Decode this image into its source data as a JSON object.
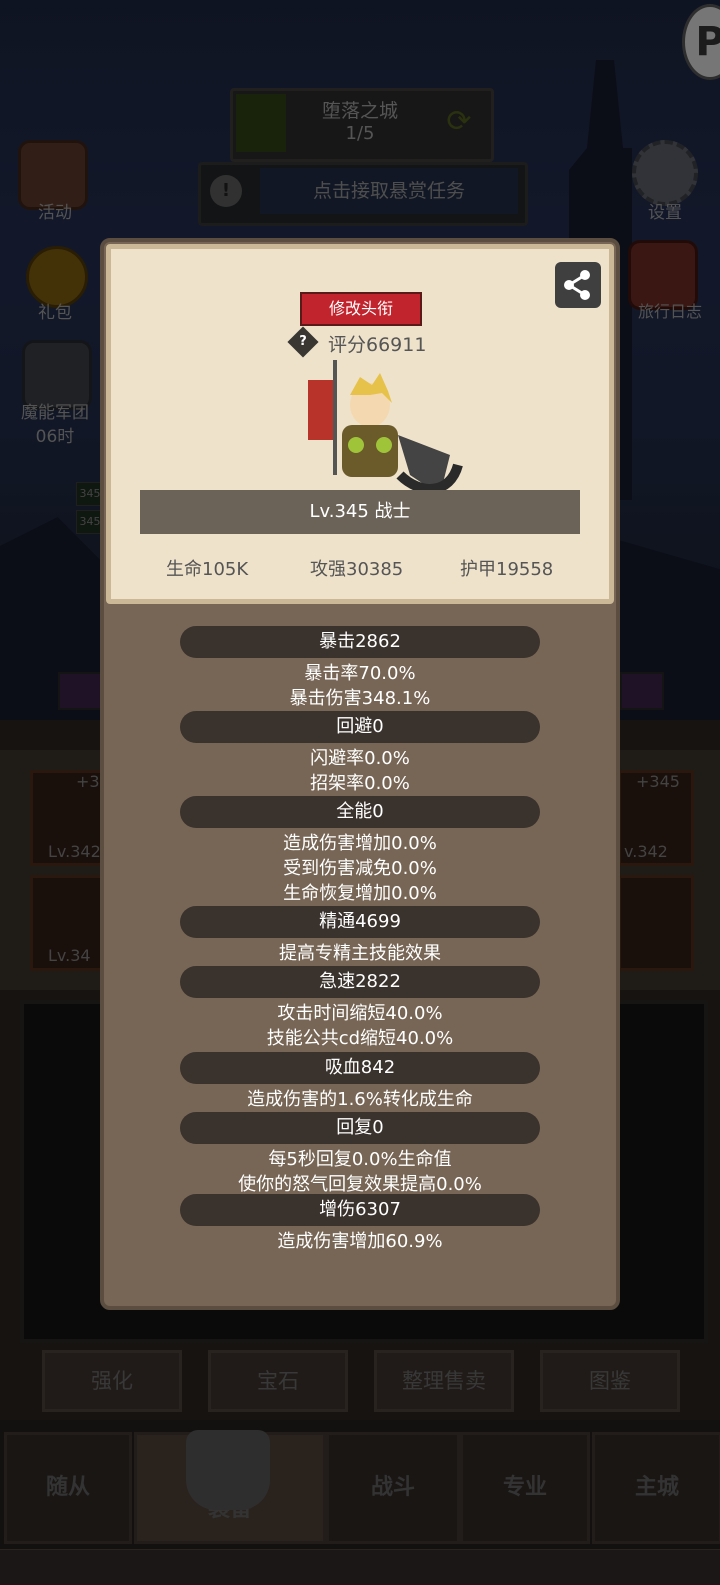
{
  "stage": {
    "name": "堕落之城",
    "progress": "1/5"
  },
  "bounty": {
    "text": "点击接取悬赏任务"
  },
  "left_menu": [
    {
      "label": "活动"
    },
    {
      "label": "礼包"
    },
    {
      "label": "魔能军团",
      "sub": "06时"
    }
  ],
  "right_menu": [
    {
      "label": "设置"
    },
    {
      "label": "旅行日志"
    }
  ],
  "behind": {
    "level_badges": [
      "345",
      "345"
    ],
    "slots_left": [
      {
        "plus": "+3",
        "level": "Lv.342"
      },
      {
        "level": "Lv.34"
      }
    ],
    "slots_right": [
      {
        "plus": "+345",
        "level": "v.342"
      }
    ],
    "action_buttons": [
      "强化",
      "宝石",
      "整理售卖",
      "图鉴"
    ],
    "nav": [
      "随从",
      "装备",
      "战斗",
      "专业",
      "主城"
    ]
  },
  "profile": {
    "change_title": "修改头衔",
    "score": "评分66911",
    "level_class": "Lv.345 战士",
    "hp": "生命105K",
    "attack": "攻强30385",
    "armor": "护甲19558"
  },
  "attributes": [
    {
      "name": "暴击2862",
      "lines": [
        "暴击率70.0%",
        "暴击伤害348.1%"
      ]
    },
    {
      "name": "回避0",
      "lines": [
        "闪避率0.0%",
        "招架率0.0%"
      ]
    },
    {
      "name": "全能0",
      "lines": [
        "造成伤害增加0.0%",
        "受到伤害减免0.0%",
        "生命恢复增加0.0%"
      ]
    },
    {
      "name": "精通4699",
      "lines": [
        "提高专精主技能效果"
      ]
    },
    {
      "name": "急速2822",
      "lines": [
        "攻击时间缩短40.0%",
        "技能公共cd缩短40.0%"
      ]
    },
    {
      "name": "吸血842",
      "lines": [
        "造成伤害的1.6%转化成生命"
      ]
    },
    {
      "name": "回复0",
      "lines": [
        "每5秒回复0.0%生命值",
        "使你的怒气回复效果提高0.0%"
      ]
    },
    {
      "name": "增伤6307",
      "lines": [
        "造成伤害增加60.9%"
      ]
    }
  ]
}
